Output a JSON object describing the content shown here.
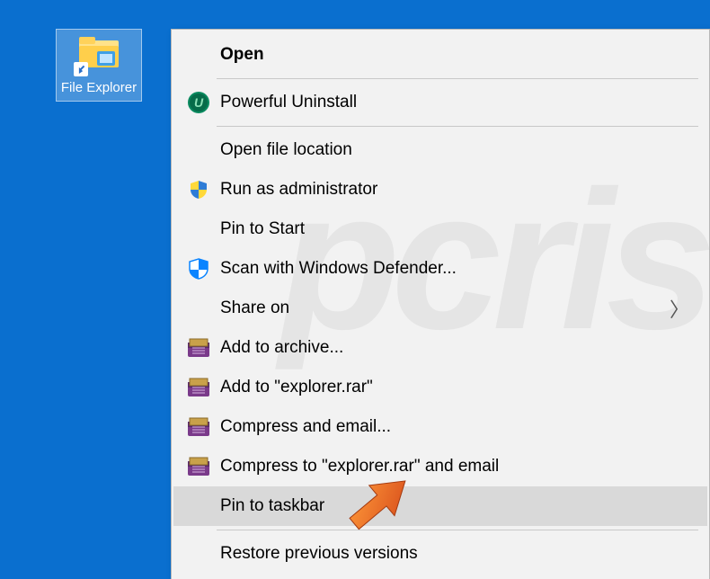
{
  "desktop": {
    "label": "File Explorer"
  },
  "menu": {
    "open": "Open",
    "powerful_uninstall": "Powerful Uninstall",
    "open_file_location": "Open file location",
    "run_as_admin": "Run as administrator",
    "pin_to_start": "Pin to Start",
    "scan_defender": "Scan with Windows Defender...",
    "share_on": "Share on",
    "add_to_archive": "Add to archive...",
    "add_to_explorer_rar": "Add to \"explorer.rar\"",
    "compress_and_email": "Compress and email...",
    "compress_to_explorer_rar_email": "Compress to \"explorer.rar\" and email",
    "pin_to_taskbar": "Pin to taskbar",
    "restore_previous": "Restore previous versions"
  },
  "watermark": "pcrisk.com"
}
